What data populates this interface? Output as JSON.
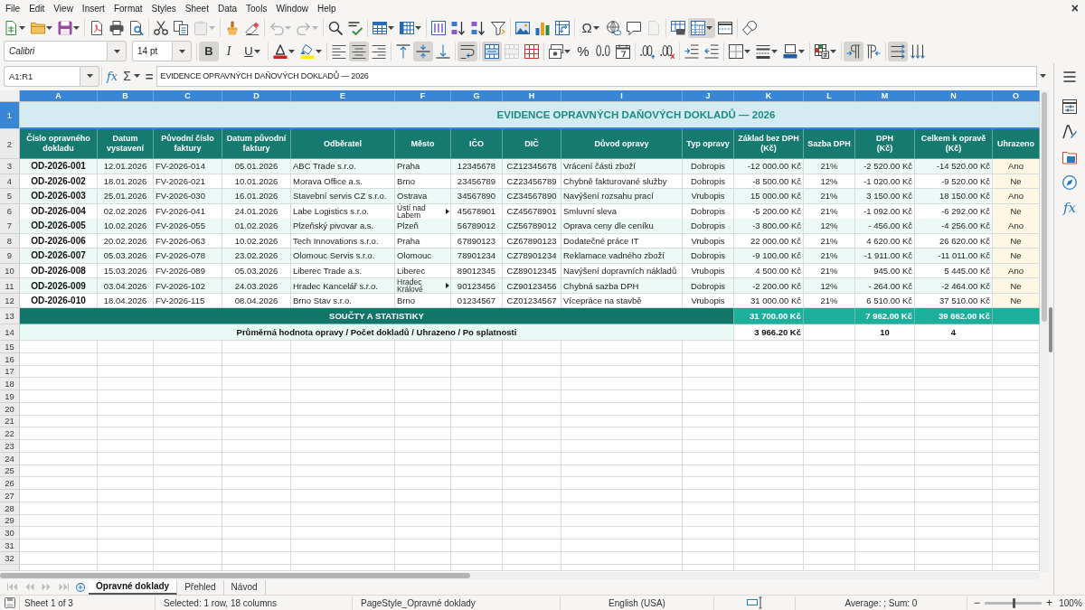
{
  "menu_bar": {
    "items": [
      "File",
      "Edit",
      "View",
      "Insert",
      "Format",
      "Styles",
      "Sheet",
      "Data",
      "Tools",
      "Window",
      "Help"
    ],
    "close": "×"
  },
  "standard_toolbar": {
    "groups": [
      [
        {
          "kind": "split",
          "pressed": false,
          "disabled": false
        },
        {
          "kind": "split",
          "pressed": false,
          "disabled": false
        },
        {
          "kind": "split",
          "pressed": false,
          "disabled": false
        }
      ],
      [
        {
          "kind": "button",
          "pressed": false,
          "disabled": false
        },
        {
          "kind": "button",
          "pressed": false,
          "disabled": false
        },
        {
          "kind": "button",
          "pressed": false,
          "disabled": false
        }
      ],
      [
        {
          "kind": "button",
          "pressed": false,
          "disabled": false
        },
        {
          "kind": "button",
          "pressed": false,
          "disabled": false
        },
        {
          "kind": "split",
          "pressed": false,
          "disabled": true
        }
      ],
      [
        {
          "kind": "button",
          "pressed": false,
          "disabled": false
        },
        {
          "kind": "button",
          "pressed": false,
          "disabled": false
        }
      ],
      [
        {
          "kind": "split",
          "pressed": false,
          "disabled": true
        },
        {
          "kind": "split",
          "pressed": false,
          "disabled": true
        }
      ],
      [
        {
          "kind": "button",
          "pressed": false,
          "disabled": false
        },
        {
          "kind": "button",
          "pressed": false,
          "disabled": false
        }
      ],
      [
        {
          "kind": "split",
          "pressed": false,
          "disabled": false
        },
        {
          "kind": "split",
          "pressed": false,
          "disabled": false
        }
      ],
      [
        {
          "kind": "button",
          "pressed": false,
          "disabled": false
        },
        {
          "kind": "button",
          "pressed": false,
          "disabled": false
        },
        {
          "kind": "button",
          "pressed": false,
          "disabled": false
        },
        {
          "kind": "button",
          "pressed": false,
          "disabled": false
        }
      ],
      [
        {
          "kind": "button",
          "pressed": false,
          "disabled": false
        },
        {
          "kind": "button",
          "pressed": false,
          "disabled": false
        },
        {
          "kind": "button",
          "pressed": false,
          "disabled": false
        }
      ],
      [
        {
          "kind": "split",
          "label": "Ω",
          "pressed": false,
          "disabled": false
        },
        {
          "kind": "button",
          "pressed": false,
          "disabled": false
        },
        {
          "kind": "button",
          "pressed": false,
          "disabled": false
        },
        {
          "kind": "button",
          "pressed": false,
          "disabled": true
        }
      ],
      [
        {
          "kind": "button",
          "pressed": false,
          "disabled": false
        },
        {
          "kind": "split",
          "pressed": true,
          "disabled": false
        },
        {
          "kind": "button",
          "pressed": false,
          "disabled": false
        }
      ],
      [
        {
          "kind": "button",
          "pressed": false,
          "disabled": false
        }
      ]
    ]
  },
  "formatting_toolbar": {
    "font_name": "Calibri",
    "font_size": "14 pt",
    "groups": [
      [
        {
          "kind": "button",
          "label": "B",
          "pressed": true,
          "disabled": false
        },
        {
          "kind": "button",
          "label": "I",
          "pressed": false,
          "disabled": false
        },
        {
          "kind": "split",
          "label": "U",
          "pressed": false,
          "disabled": false
        }
      ],
      [
        {
          "kind": "split",
          "pressed": false,
          "disabled": false
        },
        {
          "kind": "split",
          "pressed": false,
          "disabled": false
        }
      ],
      [
        {
          "kind": "button",
          "pressed": false,
          "disabled": false
        },
        {
          "kind": "button",
          "pressed": true,
          "disabled": false
        },
        {
          "kind": "button",
          "pressed": false,
          "disabled": false
        }
      ],
      [
        {
          "kind": "button",
          "pressed": false,
          "disabled": false
        },
        {
          "kind": "button",
          "pressed": true,
          "disabled": false
        },
        {
          "kind": "button",
          "pressed": false,
          "disabled": false
        }
      ],
      [
        {
          "kind": "button",
          "pressed": true,
          "disabled": false
        }
      ],
      [
        {
          "kind": "button",
          "pressed": true,
          "disabled": false
        },
        {
          "kind": "button",
          "pressed": false,
          "disabled": true
        },
        {
          "kind": "button",
          "pressed": false,
          "disabled": false
        }
      ],
      [
        {
          "kind": "split",
          "pressed": false,
          "disabled": false
        },
        {
          "kind": "button",
          "label": "%",
          "pressed": false,
          "disabled": false
        },
        {
          "kind": "button",
          "pressed": false,
          "disabled": false
        },
        {
          "kind": "button",
          "pressed": false,
          "disabled": false
        }
      ],
      [
        {
          "kind": "button",
          "pressed": false,
          "disabled": false
        },
        {
          "kind": "button",
          "pressed": false,
          "disabled": false
        }
      ],
      [
        {
          "kind": "button",
          "pressed": false,
          "disabled": false
        },
        {
          "kind": "button",
          "pressed": false,
          "disabled": false
        }
      ],
      [
        {
          "kind": "split",
          "pressed": false,
          "disabled": false
        },
        {
          "kind": "split",
          "pressed": false,
          "disabled": false
        },
        {
          "kind": "split",
          "pressed": false,
          "disabled": false
        }
      ],
      [
        {
          "kind": "split",
          "pressed": false,
          "disabled": false
        }
      ],
      [
        {
          "kind": "button",
          "pressed": true,
          "disabled": false
        },
        {
          "kind": "button",
          "pressed": false,
          "disabled": false
        }
      ],
      [
        {
          "kind": "button",
          "pressed": true,
          "disabled": false
        },
        {
          "kind": "button",
          "pressed": false,
          "disabled": false
        }
      ]
    ]
  },
  "formula_bar": {
    "name_box": "A1:R1",
    "function_wizard": "fx",
    "sum": "Σ",
    "equals": "=",
    "formula": "EVIDENCE OPRAVNÝCH DAŇOVÝCH DOKLADŮ — 2026"
  },
  "sheet": {
    "columns": [
      {
        "letter": "A",
        "selected": true,
        "kind": "doc_id",
        "heading": "Číslo opravného\ndokladu"
      },
      {
        "letter": "B",
        "selected": true,
        "kind": "date",
        "heading": "Datum\nvystavení"
      },
      {
        "letter": "C",
        "selected": true,
        "kind": "ref",
        "heading": "Původní číslo\nfaktury"
      },
      {
        "letter": "D",
        "selected": true,
        "kind": "date",
        "heading": "Datum původní\nfaktury"
      },
      {
        "letter": "E",
        "selected": true,
        "kind": "text",
        "heading": "Odběratel"
      },
      {
        "letter": "F",
        "selected": true,
        "kind": "place",
        "heading": "Město"
      },
      {
        "letter": "G",
        "selected": true,
        "kind": "number",
        "heading": "IČO"
      },
      {
        "letter": "H",
        "selected": true,
        "kind": "number",
        "heading": "DIČ"
      },
      {
        "letter": "I",
        "selected": true,
        "kind": "text",
        "heading": "Důvod opravy"
      },
      {
        "letter": "J",
        "selected": true,
        "kind": "category",
        "heading": "Typ opravy"
      },
      {
        "letter": "K",
        "selected": true,
        "kind": "money",
        "heading": "Základ bez DPH\n(Kč)"
      },
      {
        "letter": "L",
        "selected": true,
        "kind": "percent",
        "heading": "Sazba DPH"
      },
      {
        "letter": "M",
        "selected": true,
        "kind": "money",
        "heading": "DPH\n(Kč)"
      },
      {
        "letter": "N",
        "selected": true,
        "kind": "money",
        "heading": "Celkem k opravě\n(Kč)"
      },
      {
        "letter": "O",
        "selected": true,
        "kind": "flag",
        "heading": "Uhrazeno"
      }
    ],
    "title_row": {
      "number": "1",
      "selected": true,
      "title": "EVIDENCE OPRAVNÝCH DAŇOVÝCH DOKLADŮ — 2026"
    },
    "header_row": {
      "number": "2",
      "selected": false
    },
    "rows": [
      {
        "number": "3",
        "selected": false,
        "city_clipped": false,
        "cells": [
          "OD-2026-001",
          "12.01.2026",
          "FV-2026-014",
          "05.01.2026",
          "ABC Trade s.r.o.",
          "Praha",
          "12345678",
          "CZ12345678",
          "Vrácení části zboží",
          "Dobropis",
          "-12 000.00 Kč",
          "21%",
          "-2 520.00 Kč",
          "-14 520.00 Kč",
          "Ano"
        ]
      },
      {
        "number": "4",
        "selected": false,
        "city_clipped": false,
        "cells": [
          "OD-2026-002",
          "18.01.2026",
          "FV-2026-021",
          "10.01.2026",
          "Morava Office a.s.",
          "Brno",
          "23456789",
          "CZ23456789",
          "Chybně fakturované služby",
          "Dobropis",
          "-8 500.00 Kč",
          "12%",
          "-1 020.00 Kč",
          "-9 520.00 Kč",
          "Ne"
        ]
      },
      {
        "number": "5",
        "selected": false,
        "city_clipped": false,
        "cells": [
          "OD-2026-003",
          "25.01.2026",
          "FV-2026-030",
          "16.01.2026",
          "Stavební servis CZ s.r.o.",
          "Ostrava",
          "34567890",
          "CZ34567890",
          "Navýšení rozsahu prací",
          "Vrubopis",
          "15 000.00 Kč",
          "21%",
          "3 150.00 Kč",
          "18 150.00 Kč",
          "Ano"
        ]
      },
      {
        "number": "6",
        "selected": false,
        "city_clipped": true,
        "cells": [
          "OD-2026-004",
          "02.02.2026",
          "FV-2026-041",
          "24.01.2026",
          "Labe Logistics s.r.o.",
          "Ústí nad Labem",
          "45678901",
          "CZ45678901",
          "Smluvní sleva",
          "Dobropis",
          "-5 200.00 Kč",
          "21%",
          "-1 092.00 Kč",
          "-6 292.00 Kč",
          "Ne"
        ]
      },
      {
        "number": "7",
        "selected": false,
        "city_clipped": false,
        "cells": [
          "OD-2026-005",
          "10.02.2026",
          "FV-2026-055",
          "01.02.2026",
          "Plzeňský pivovar a.s.",
          "Plzeň",
          "56789012",
          "CZ56789012",
          "Oprava ceny dle ceníku",
          "Dobropis",
          "-3 800.00 Kč",
          "12%",
          "- 456.00 Kč",
          "-4 256.00 Kč",
          "Ano"
        ]
      },
      {
        "number": "8",
        "selected": false,
        "city_clipped": false,
        "cells": [
          "OD-2026-006",
          "20.02.2026",
          "FV-2026-063",
          "10.02.2026",
          "Tech Innovations s.r.o.",
          "Praha",
          "67890123",
          "CZ67890123",
          "Dodatečné práce IT",
          "Vrubopis",
          "22 000.00 Kč",
          "21%",
          "4 620.00 Kč",
          "26 620.00 Kč",
          "Ne"
        ]
      },
      {
        "number": "9",
        "selected": false,
        "city_clipped": false,
        "cells": [
          "OD-2026-007",
          "05.03.2026",
          "FV-2026-078",
          "23.02.2026",
          "Olomouc Servis s.r.o.",
          "Olomouc",
          "78901234",
          "CZ78901234",
          "Reklamace vadného zboží",
          "Dobropis",
          "-9 100.00 Kč",
          "21%",
          "-1 911.00 Kč",
          "-11 011.00 Kč",
          "Ne"
        ]
      },
      {
        "number": "10",
        "selected": false,
        "city_clipped": false,
        "cells": [
          "OD-2026-008",
          "15.03.2026",
          "FV-2026-089",
          "05.03.2026",
          "Liberec Trade a.s.",
          "Liberec",
          "89012345",
          "CZ89012345",
          "Navýšení dopravních nákladů",
          "Vrubopis",
          "4 500.00 Kč",
          "21%",
          "945.00 Kč",
          "5 445.00 Kč",
          "Ano"
        ]
      },
      {
        "number": "11",
        "selected": false,
        "city_clipped": true,
        "cells": [
          "OD-2026-009",
          "03.04.2026",
          "FV-2026-102",
          "24.03.2026",
          "Hradec Kancelář s.r.o.",
          "Hradec Králové",
          "90123456",
          "CZ90123456",
          "Chybná sazba DPH",
          "Dobropis",
          "-2 200.00 Kč",
          "12%",
          "- 264.00 Kč",
          "-2 464.00 Kč",
          "Ne"
        ]
      },
      {
        "number": "12",
        "selected": false,
        "city_clipped": false,
        "cells": [
          "OD-2026-010",
          "18.04.2026",
          "FV-2026-115",
          "08.04.2026",
          "Brno Stav s.r.o.",
          "Brno",
          "01234567",
          "CZ01234567",
          "Vícepráce na stavbě",
          "Vrubopis",
          "31 000.00 Kč",
          "21%",
          "6 510.00 Kč",
          "37 510.00 Kč",
          "Ne"
        ]
      }
    ],
    "totals_row": {
      "number": "13",
      "selected": false,
      "label": "SOUČTY A STATISTIKY",
      "base": "31 700.00 Kč",
      "vat": "7 962.00 Kč",
      "total": "39 662.00 Kč"
    },
    "statistics_row": {
      "number": "14",
      "selected": false,
      "label": "Průměrná hodnota opravy / Počet dokladů / Uhrazeno / Po splatnosti",
      "average": "3 966.20 Kč",
      "count": "10",
      "paid": "4"
    },
    "empty_rows": [
      {
        "number": "15",
        "selected": false
      },
      {
        "number": "16",
        "selected": false
      },
      {
        "number": "17",
        "selected": false
      },
      {
        "number": "18",
        "selected": false
      },
      {
        "number": "19",
        "selected": false
      },
      {
        "number": "20",
        "selected": false
      },
      {
        "number": "21",
        "selected": false
      },
      {
        "number": "22",
        "selected": false
      },
      {
        "number": "23",
        "selected": false
      },
      {
        "number": "24",
        "selected": false
      },
      {
        "number": "25",
        "selected": false
      },
      {
        "number": "26",
        "selected": false
      },
      {
        "number": "27",
        "selected": false
      },
      {
        "number": "28",
        "selected": false
      },
      {
        "number": "29",
        "selected": false
      },
      {
        "number": "30",
        "selected": false
      },
      {
        "number": "31",
        "selected": false
      },
      {
        "number": "32",
        "selected": false
      }
    ]
  },
  "sheet_tabs": {
    "navigation": [
      {
        "disabled": true
      },
      {
        "disabled": true
      },
      {
        "disabled": true
      },
      {
        "disabled": true
      }
    ],
    "tabs": [
      {
        "label": "Opravné doklady",
        "selected": true
      },
      {
        "label": "Přehled",
        "selected": false
      },
      {
        "label": "Návod",
        "selected": false
      }
    ]
  },
  "sidebar": {
    "functions": "fx"
  },
  "status_bar": {
    "sheet": "Sheet 1 of 3",
    "selection": "Selected: 1 row, 18 columns",
    "page_style": "PageStyle_Opravné doklady",
    "language": "English (USA)",
    "statistics": "Average: ; Sum: 0",
    "zoom": {
      "minus": "−",
      "plus": "+",
      "level": 0.5,
      "reading": "100%"
    }
  }
}
